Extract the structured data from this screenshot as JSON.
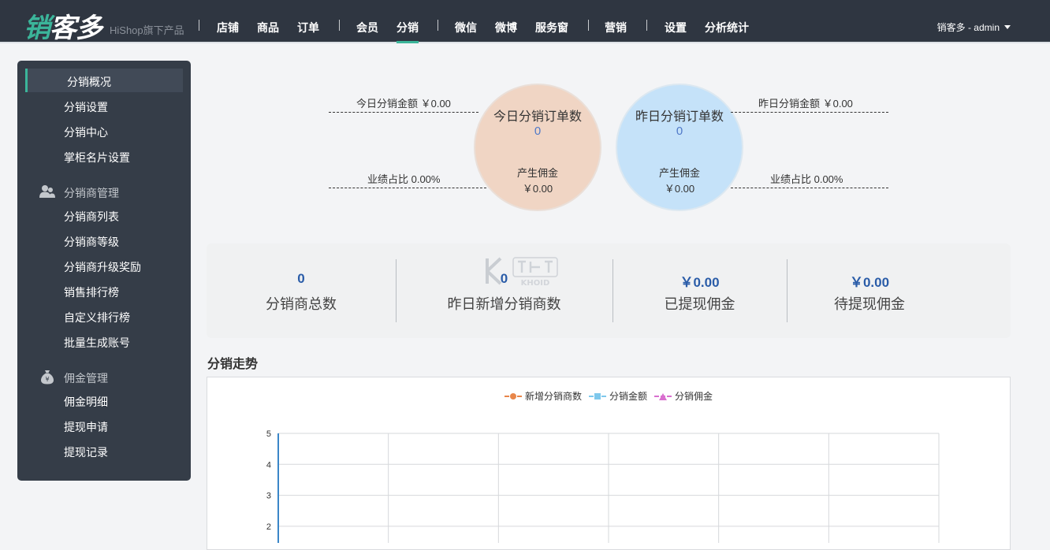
{
  "header": {
    "logo_text": "销客多",
    "logo_sub": "HiShop旗下产品",
    "nav": [
      {
        "label": "店铺"
      },
      {
        "label": "商品"
      },
      {
        "label": "订单"
      },
      {
        "label": "会员"
      },
      {
        "label": "分销",
        "active": true
      },
      {
        "label": "微信"
      },
      {
        "label": "微博"
      },
      {
        "label": "服务窗"
      },
      {
        "label": "营销"
      },
      {
        "label": "设置"
      },
      {
        "label": "分析统计"
      }
    ],
    "user": "销客多 - admin"
  },
  "sidebar": {
    "items": [
      {
        "label": "分销概况",
        "active": true
      },
      {
        "label": "分销设置"
      },
      {
        "label": "分销中心"
      },
      {
        "label": "掌柜名片设置"
      }
    ],
    "groups": [
      {
        "title": "分销商管理",
        "icon": "users-icon",
        "items": [
          "分销商列表",
          "分销商等级",
          "分销商升级奖励",
          "销售排行榜",
          "自定义排行榜",
          "批量生成账号"
        ]
      },
      {
        "title": "佣金管理",
        "icon": "money-bag-icon",
        "items": [
          "佣金明细",
          "提现申请",
          "提现记录"
        ]
      }
    ]
  },
  "overview": {
    "today": {
      "title": "今日分销订单数",
      "orders": "0",
      "commission_label": "产生佣金",
      "commission": "￥0.00",
      "amount_label": "今日分销金额 ￥0.00",
      "ratio_label": "业绩占比 0.00%"
    },
    "yesterday": {
      "title": "昨日分销订单数",
      "orders": "0",
      "commission_label": "产生佣金",
      "commission": "￥0.00",
      "amount_label": "昨日分销金额 ￥0.00",
      "ratio_label": "业绩占比 0.00%"
    }
  },
  "stats": [
    {
      "value": "0",
      "label": "分销商总数"
    },
    {
      "value": "0",
      "label": "昨日新增分销商数"
    },
    {
      "value": "￥0.00",
      "label": "已提现佣金"
    },
    {
      "value": "￥0.00",
      "label": "待提现佣金"
    }
  ],
  "watermark": "KHOID",
  "trend": {
    "title": "分销走势",
    "legend": [
      {
        "name": "新增分销商数",
        "color": "#e8864a"
      },
      {
        "name": "分销金额",
        "color": "#7ec8ec"
      },
      {
        "name": "分销佣金",
        "color": "#d96fcf"
      }
    ]
  },
  "chart_data": {
    "type": "line",
    "title": "分销走势",
    "series": [
      {
        "name": "新增分销商数",
        "values": []
      },
      {
        "name": "分销金额",
        "values": []
      },
      {
        "name": "分销佣金",
        "values": []
      }
    ],
    "y_ticks": [
      5,
      4,
      3,
      2
    ],
    "ylim": [
      0,
      5
    ],
    "grid": true,
    "legend_position": "top-center"
  }
}
